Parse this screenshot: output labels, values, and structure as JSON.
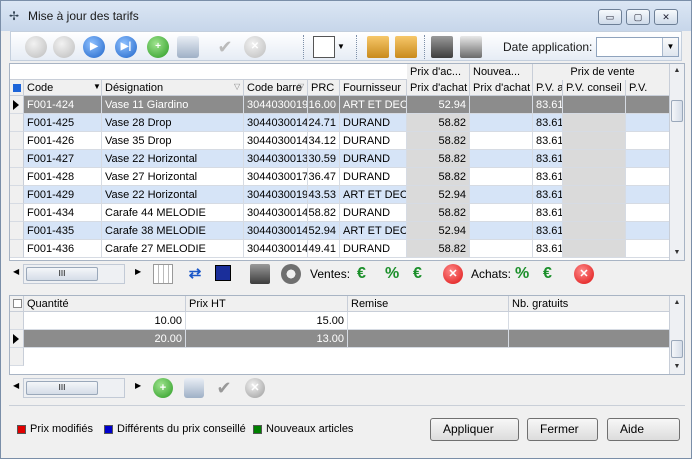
{
  "window": {
    "title": "Mise à jour des tarifs",
    "minimize": "▭",
    "maximize": "▢",
    "close": "✕"
  },
  "toolbar": {
    "date_label": "Date application:",
    "date_value": "",
    "dropdown_glyph": "▼"
  },
  "grid": {
    "group_headers": [
      "Prix d'ac...",
      "Nouvea...",
      "Prix de vente"
    ],
    "columns": [
      "Code",
      "Désignation",
      "Code barre",
      "PRC",
      "Fournisseur",
      "Prix d'achat",
      "Prix d'achat",
      "P.V. a",
      "P.V. conseil",
      "P.V."
    ],
    "rows": [
      [
        "F001-424",
        "Vase 11 Giardino",
        "3044030019",
        "16.00",
        "ART ET DEC",
        "52.94",
        "",
        "83.61",
        "",
        ""
      ],
      [
        "F001-425",
        "Vase 28 Drop",
        "3044030014",
        "24.71",
        "DURAND",
        "58.82",
        "",
        "83.61",
        "",
        ""
      ],
      [
        "F001-426",
        "Vase 35 Drop",
        "3044030014",
        "34.12",
        "DURAND",
        "58.82",
        "",
        "83.61",
        "",
        ""
      ],
      [
        "F001-427",
        "Vase 22 Horizontal",
        "3044030013",
        "30.59",
        "DURAND",
        "58.82",
        "",
        "83.61",
        "",
        ""
      ],
      [
        "F001-428",
        "Vase 27 Horizontal",
        "3044030017",
        "36.47",
        "DURAND",
        "58.82",
        "",
        "83.61",
        "",
        ""
      ],
      [
        "F001-429",
        "Vase 22 Horizontal",
        "3044030019",
        "43.53",
        "ART ET DEC",
        "52.94",
        "",
        "83.61",
        "",
        ""
      ],
      [
        "F001-434",
        "Carafe 44 MELODIE",
        "3044030014",
        "58.82",
        "DURAND",
        "58.82",
        "",
        "83.61",
        "",
        ""
      ],
      [
        "F001-435",
        "Carafe 38 MELODIE",
        "3044030014",
        "52.94",
        "ART ET DEC",
        "52.94",
        "",
        "83.61",
        "",
        ""
      ],
      [
        "F001-436",
        "Carafe 27 MELODIE",
        "3044030014",
        "49.41",
        "DURAND",
        "58.82",
        "",
        "83.61",
        "",
        ""
      ]
    ],
    "hscroll_thumb": "III"
  },
  "middle_bar": {
    "ventes_label": "Ventes:",
    "achats_label": "Achats:",
    "percent": "%"
  },
  "qty_grid": {
    "columns": [
      "Quantité",
      "Prix HT",
      "Remise",
      "Nb. gratuits"
    ],
    "rows": [
      [
        "10.00",
        "15.00",
        "",
        ""
      ],
      [
        "20.00",
        "13.00",
        "",
        ""
      ]
    ],
    "hscroll_thumb": "III"
  },
  "legend": {
    "modified": "Prix modifiés",
    "different": "Différents du prix conseillé",
    "new": "Nouveaux articles"
  },
  "colors": {
    "modified": "#e00000",
    "different": "#0000cc",
    "new": "#008000"
  },
  "buttons": {
    "apply": "Appliquer",
    "close": "Fermer",
    "help": "Aide"
  }
}
